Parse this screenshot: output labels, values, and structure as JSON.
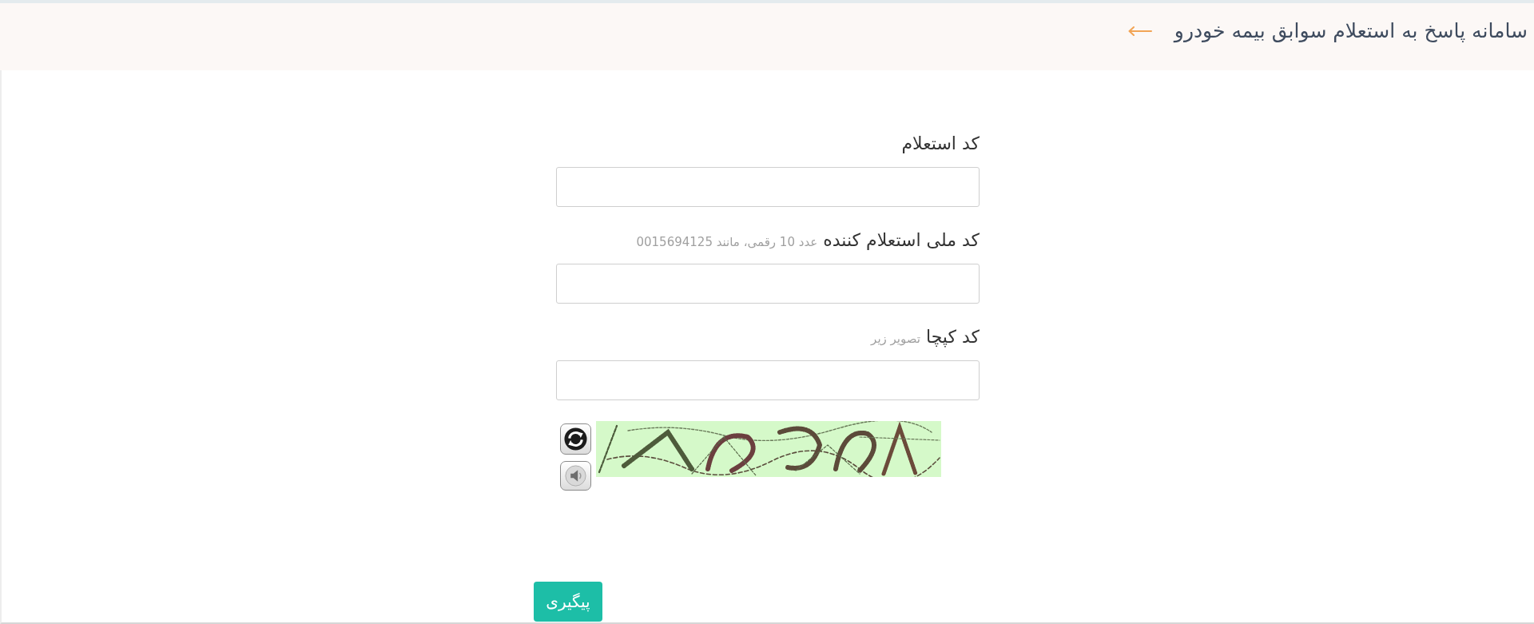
{
  "header": {
    "title": "سامانه پاسخ به استعلام سوابق بیمه خودرو"
  },
  "form": {
    "fields": [
      {
        "label": "کد استعلام"
      },
      {
        "label": "کد ملی استعلام کننده",
        "hint": "عدد 10 رقمی، مانند 0015694125"
      },
      {
        "label": "کد کپچا",
        "hint": "تصویر زیر"
      }
    ]
  },
  "submit_button": {
    "label": "پیگیری"
  }
}
